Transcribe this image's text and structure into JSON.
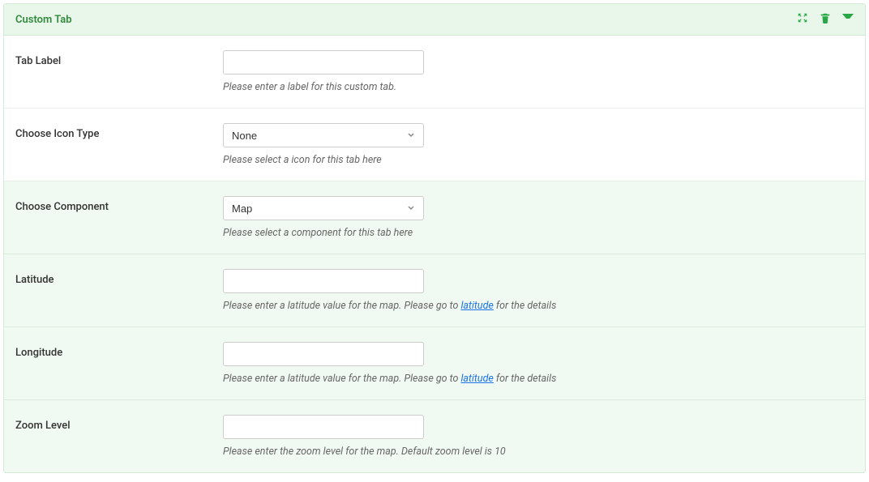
{
  "panel": {
    "title": "Custom Tab"
  },
  "fields": {
    "tab_label": {
      "label": "Tab Label",
      "value": "",
      "help": "Please enter a label for this custom tab."
    },
    "icon_type": {
      "label": "Choose Icon Type",
      "selected": "None",
      "help": "Please select a icon for this tab here"
    },
    "component": {
      "label": "Choose Component",
      "selected": "Map",
      "help": "Please select a component for this tab here"
    },
    "latitude": {
      "label": "Latitude",
      "value": "",
      "help_prefix": "Please enter a latitude value for the map. Please go to ",
      "help_link": "latitude",
      "help_suffix": " for the details"
    },
    "longitude": {
      "label": "Longitude",
      "value": "",
      "help_prefix": "Please enter a latitude value for the map. Please go to ",
      "help_link": "latitude",
      "help_suffix": " for the details"
    },
    "zoom": {
      "label": "Zoom Level",
      "value": "",
      "help": "Please enter the zoom level for the map. Default zoom level is 10"
    }
  }
}
